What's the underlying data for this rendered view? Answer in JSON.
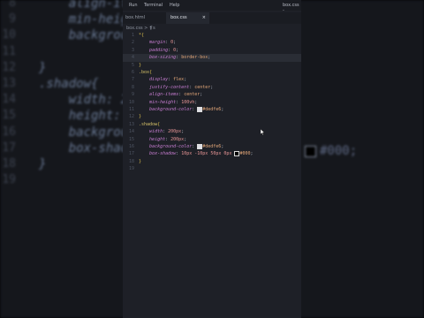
{
  "menu": {
    "run": "Run",
    "terminal": "Terminal",
    "help": "Help",
    "title": "box.css -"
  },
  "tabs": [
    {
      "label": "box.html"
    },
    {
      "label": "box.css",
      "close": "×"
    }
  ],
  "breadcrumb": "box.css > ❡s",
  "background_zoom": {
    "lines": [
      {
        "num": "8",
        "text": "    align-it"
      },
      {
        "num": "9",
        "text": "    min-heig"
      },
      {
        "num": "10",
        "text": "    backgrou"
      },
      {
        "num": "11",
        "text": ""
      },
      {
        "num": "12",
        "text": "}"
      },
      {
        "num": "13",
        "text": ".shadow{"
      },
      {
        "num": "14",
        "text": "    width: 2"
      },
      {
        "num": "15",
        "text": "    height:"
      },
      {
        "num": "16",
        "text": "    backgrou"
      },
      {
        "num": "17",
        "text": "    box-shad"
      },
      {
        "num": "18",
        "text": "}"
      },
      {
        "num": "19",
        "text": ""
      }
    ],
    "color_text": "#000;"
  },
  "code_lines": [
    {
      "num": "1",
      "html": "<span class='b'>*{</span>"
    },
    {
      "num": "2",
      "html": "    <span class='p'>margin</span>: <span class='n'>0</span>;"
    },
    {
      "num": "3",
      "html": "    <span class='p'>padding</span>: <span class='n'>0</span>;"
    },
    {
      "num": "4",
      "html": "    <span class='p'>box-sizing</span>: <span class='v'>border-box</span>;",
      "current": true
    },
    {
      "num": "5",
      "html": "<span class='b'>}</span>"
    },
    {
      "num": "6",
      "html": "<span class='sel'>.box</span><span class='b'>{</span>"
    },
    {
      "num": "7",
      "html": "    <span class='p'>display</span>: <span class='v'>flex</span>;"
    },
    {
      "num": "8",
      "html": "    <span class='p'>justify-content</span>: <span class='v'>center</span>;"
    },
    {
      "num": "9",
      "html": "    <span class='p'>align-items</span>: <span class='v'>center</span>;"
    },
    {
      "num": "10",
      "html": "    <span class='p'>min-height</span>: <span class='n'>100vh</span>;"
    },
    {
      "num": "11",
      "html": "    <span class='p'>background-color</span>: <span class='sw'></span><span class='v'>#dedfe6</span>;"
    },
    {
      "num": "12",
      "html": "<span class='b'>}</span>"
    },
    {
      "num": "13",
      "html": "<span class='sel'>.shadow</span><span class='b'>{</span>"
    },
    {
      "num": "14",
      "html": "    <span class='p'>width</span>: <span class='n'>200px</span>;"
    },
    {
      "num": "15",
      "html": "    <span class='p'>height</span>: <span class='n'>200px</span>;"
    },
    {
      "num": "16",
      "html": "    <span class='p'>background-color</span>: <span class='sw'></span><span class='v'>#dedfe6</span>;"
    },
    {
      "num": "17",
      "html": "    <span class='p'>box-shadow</span>: <span class='n'>10px</span> <span class='n'>-10px</span> <span class='n'>50px</span> <span class='n'>0px</span> <span class='sw black'></span><span class='v'>#000</span>;"
    },
    {
      "num": "18",
      "html": "<span class='b'>}</span>"
    },
    {
      "num": "19",
      "html": ""
    }
  ]
}
